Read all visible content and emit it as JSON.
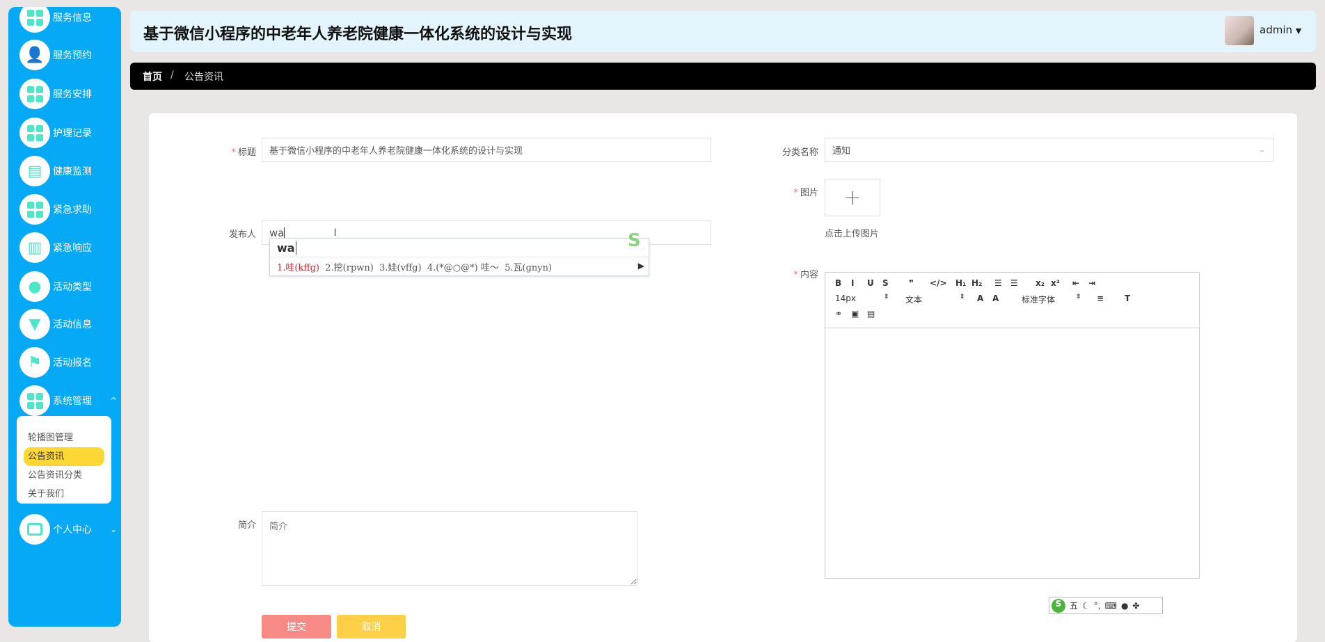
{
  "sidebar": {
    "items": [
      {
        "label": "服务信息",
        "icon": "grid-icon"
      },
      {
        "label": "服务预约",
        "icon": "user-icon"
      },
      {
        "label": "服务安排",
        "icon": "grid-icon"
      },
      {
        "label": "护理记录",
        "icon": "grid-icon"
      },
      {
        "label": "健康监测",
        "icon": "chat-icon"
      },
      {
        "label": "紧急求助",
        "icon": "grid-icon"
      },
      {
        "label": "紧急响应",
        "icon": "chart-icon"
      },
      {
        "label": "活动类型",
        "icon": "bulb-icon"
      },
      {
        "label": "活动信息",
        "icon": "monitor-icon"
      },
      {
        "label": "活动报名",
        "icon": "flag-icon"
      },
      {
        "label": "系统管理",
        "icon": "grid-icon"
      }
    ],
    "submenu": [
      "轮播图管理",
      "公告资讯",
      "公告资讯分类",
      "关于我们"
    ],
    "personal": "个人中心"
  },
  "header": {
    "title": "基于微信小程序的中老年人养老院健康一体化系统的设计与实现",
    "user": "admin"
  },
  "breadcrumb": {
    "home": "首页",
    "sep": "/",
    "current": "公告资讯"
  },
  "form": {
    "title_label": "标题",
    "title_value": "基于微信小程序的中老年人养老院健康一体化系统的设计与实现",
    "category_label": "分类名称",
    "category_value": "通知",
    "image_label": "图片",
    "upload_hint": "点击上传图片",
    "publisher_label": "发布人",
    "publisher_value": "wa",
    "content_label": "内容",
    "intro_label": "简介",
    "intro_placeholder": "简介",
    "submit": "提交",
    "cancel": "取消"
  },
  "ime": {
    "composition": "wa",
    "candidates": [
      "1.哇(kffg)",
      "2.挖(rpwn)",
      "3.娃(vffg)",
      "4.(*@○@*) 哇～",
      "5.瓦(gnyn)"
    ],
    "status": "五"
  },
  "editor": {
    "toolbar1": [
      "B",
      "I",
      "U",
      "S",
      "❞",
      "</>",
      "H₁",
      "H₂",
      "☰",
      "☰",
      "x₂",
      "x²",
      "⇤",
      "⇥"
    ],
    "size": "14px",
    "header": "文本",
    "font": "标准字体"
  }
}
